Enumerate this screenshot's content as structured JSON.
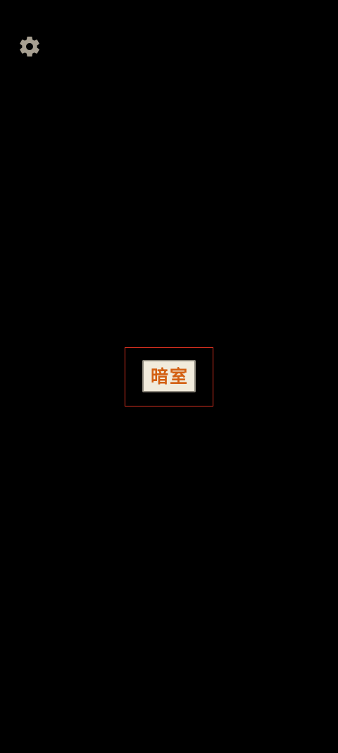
{
  "settings": {
    "icon": "gear-icon",
    "color": "#a79f91"
  },
  "main": {
    "start_label": "暗室",
    "button_background": "#f1ebdc",
    "button_border": "#8d887d",
    "text_color": "#d35f12",
    "highlight_color": "#d32f1f"
  }
}
